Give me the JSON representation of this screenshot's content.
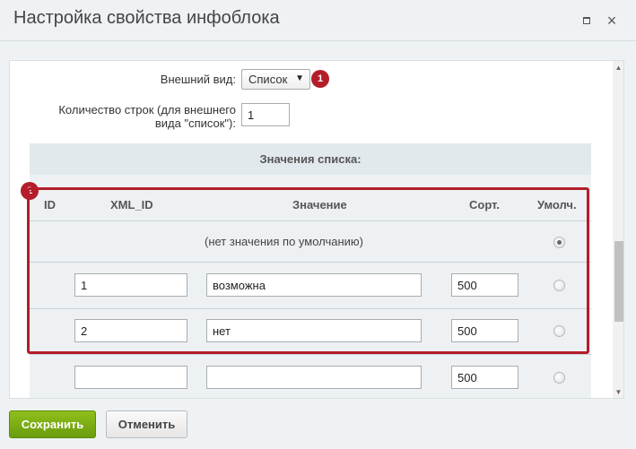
{
  "window": {
    "title": "Настройка свойства инфоблока",
    "maximize_icon": "maximize-icon",
    "close_icon": "close-icon",
    "close_glyph": "×"
  },
  "form": {
    "appearance_label": "Внешний вид:",
    "appearance_value": "Список",
    "rows_label_line1": "Количество строк (для внешнего",
    "rows_label_line2": "вида \"список\"):",
    "rows_value": "1",
    "badge1": "1",
    "badge2": "2"
  },
  "list_section": {
    "title": "Значения списка:",
    "columns": {
      "id": "ID",
      "xml_id": "XML_ID",
      "value": "Значение",
      "sort": "Сорт.",
      "default": "Умолч."
    },
    "no_default_text": "(нет значения по умолчанию)",
    "rows": [
      {
        "xml_id": "1",
        "value": "возможна",
        "sort": "500",
        "default": false
      },
      {
        "xml_id": "2",
        "value": "нет",
        "sort": "500",
        "default": false
      },
      {
        "xml_id": "",
        "value": "",
        "sort": "500",
        "default": false
      }
    ],
    "no_default_selected": true
  },
  "footer": {
    "save_label": "Сохранить",
    "cancel_label": "Отменить"
  },
  "colors": {
    "accent_red": "#b31e2a",
    "save_green": "#76a712"
  }
}
